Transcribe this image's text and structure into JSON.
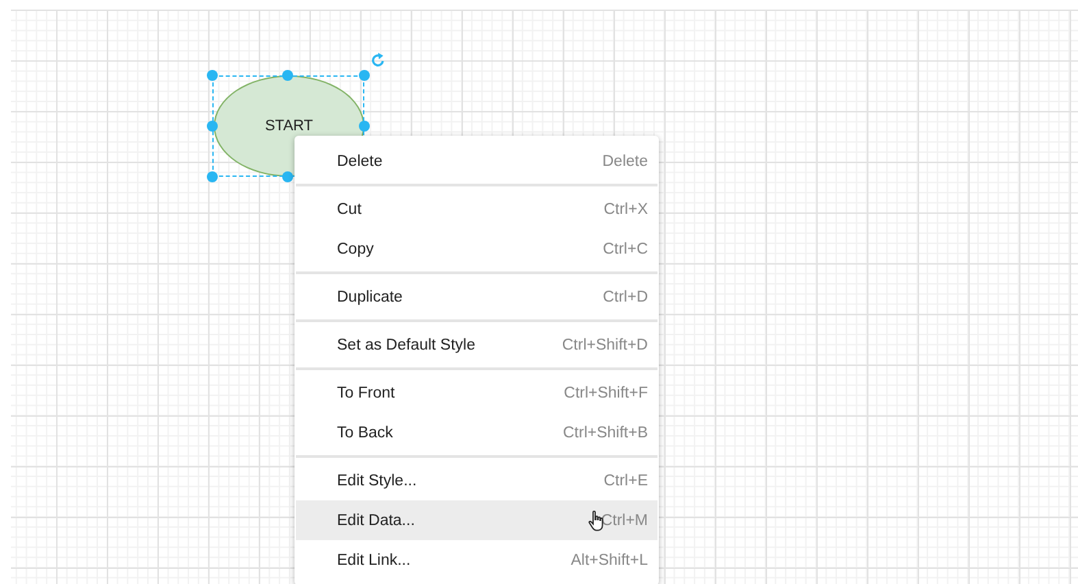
{
  "canvas": {
    "shape": {
      "kind": "ellipse",
      "label": "START",
      "selected": true
    }
  },
  "context_menu": {
    "groups": [
      {
        "items": [
          {
            "label": "Delete",
            "shortcut": "Delete",
            "selected": false
          }
        ]
      },
      {
        "items": [
          {
            "label": "Cut",
            "shortcut": "Ctrl+X",
            "selected": false
          },
          {
            "label": "Copy",
            "shortcut": "Ctrl+C",
            "selected": false
          }
        ]
      },
      {
        "items": [
          {
            "label": "Duplicate",
            "shortcut": "Ctrl+D",
            "selected": false
          }
        ]
      },
      {
        "items": [
          {
            "label": "Set as Default Style",
            "shortcut": "Ctrl+Shift+D",
            "selected": false
          }
        ]
      },
      {
        "items": [
          {
            "label": "To Front",
            "shortcut": "Ctrl+Shift+F",
            "selected": false
          },
          {
            "label": "To Back",
            "shortcut": "Ctrl+Shift+B",
            "selected": false
          }
        ]
      },
      {
        "items": [
          {
            "label": "Edit Style...",
            "shortcut": "Ctrl+E",
            "selected": false
          },
          {
            "label": "Edit Data...",
            "shortcut": "Ctrl+M",
            "selected": true
          },
          {
            "label": "Edit Link...",
            "shortcut": "Alt+Shift+L",
            "selected": false
          }
        ]
      }
    ]
  }
}
